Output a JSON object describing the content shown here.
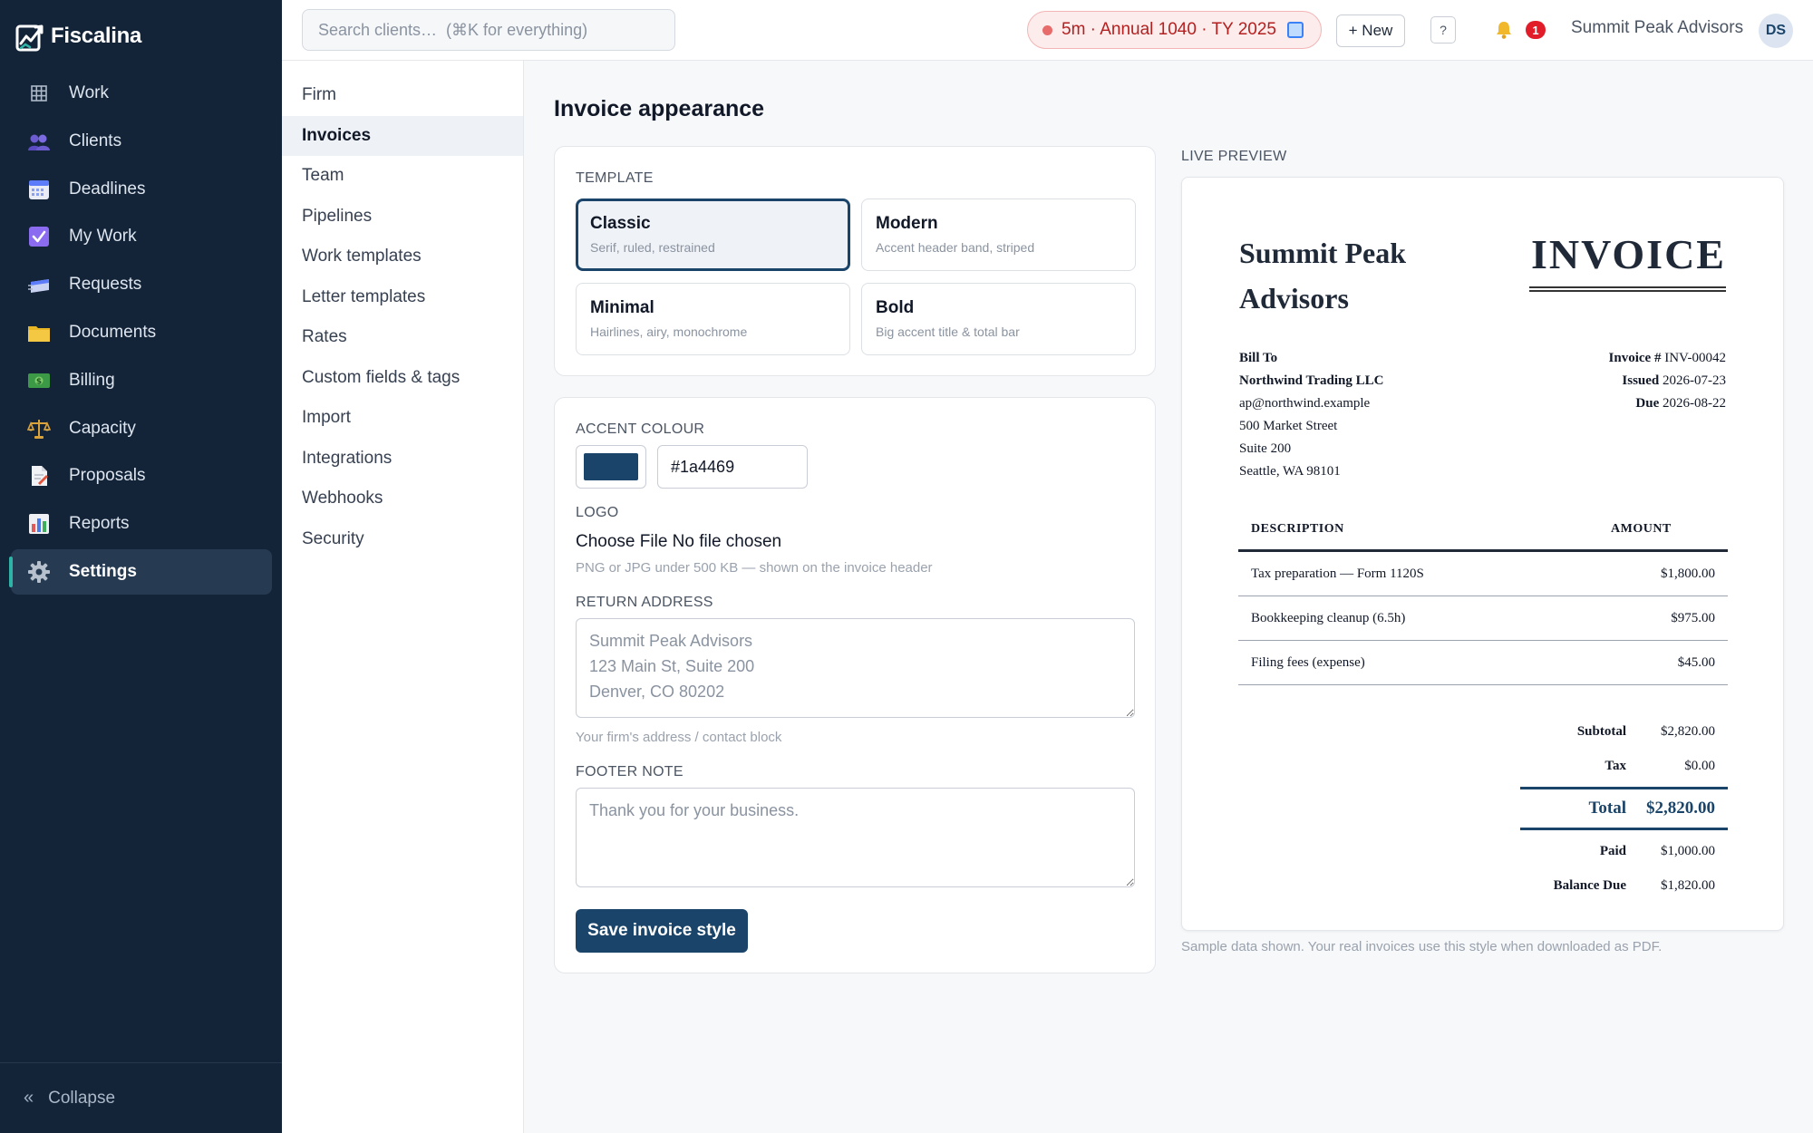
{
  "app": {
    "name": "Fiscalina"
  },
  "sidebar": {
    "items": [
      {
        "label": "Work",
        "icon": "grid-icon"
      },
      {
        "label": "Clients",
        "icon": "people-icon"
      },
      {
        "label": "Deadlines",
        "icon": "calendar-icon"
      },
      {
        "label": "My Work",
        "icon": "checkbox-icon"
      },
      {
        "label": "Requests",
        "icon": "inbox-icon"
      },
      {
        "label": "Documents",
        "icon": "folder-icon"
      },
      {
        "label": "Billing",
        "icon": "cash-icon"
      },
      {
        "label": "Capacity",
        "icon": "scales-icon"
      },
      {
        "label": "Proposals",
        "icon": "proposal-icon"
      },
      {
        "label": "Reports",
        "icon": "bar-chart-icon"
      },
      {
        "label": "Settings",
        "icon": "gear-icon",
        "active": true
      }
    ],
    "collapse_label": "Collapse"
  },
  "topbar": {
    "search_placeholder": "Search clients…  (⌘K for everything)",
    "timer_text": "5m · Annual 1040 · TY 2025",
    "new_label": "+ New",
    "help_label": "?",
    "notification_count": "1",
    "firm_name": "Summit Peak Advisors",
    "avatar_initials": "DS"
  },
  "settings_nav": {
    "items": [
      "Firm",
      "Invoices",
      "Team",
      "Pipelines",
      "Work templates",
      "Letter templates",
      "Rates",
      "Custom fields & tags",
      "Import",
      "Integrations",
      "Webhooks",
      "Security"
    ],
    "active": "Invoices"
  },
  "page": {
    "title": "Invoice appearance",
    "template_label": "TEMPLATE",
    "templates": [
      {
        "name": "Classic",
        "desc": "Serif, ruled, restrained",
        "selected": true
      },
      {
        "name": "Modern",
        "desc": "Accent header band, striped"
      },
      {
        "name": "Minimal",
        "desc": "Hairlines, airy, monochrome"
      },
      {
        "name": "Bold",
        "desc": "Big accent title & total bar"
      }
    ],
    "accent_label": "ACCENT COLOUR",
    "accent_value": "#1a4469",
    "logo_label": "LOGO",
    "logo_button": "Choose File",
    "logo_status": "No file chosen",
    "logo_hint": "PNG or JPG under 500 KB — shown on the invoice header",
    "return_address_label": "RETURN ADDRESS",
    "return_address_placeholder": "Summit Peak Advisors\n123 Main St, Suite 200\nDenver, CO 80202",
    "return_address_hint": "Your firm's address / contact block",
    "footer_label": "FOOTER NOTE",
    "footer_placeholder": "Thank you for your business.",
    "save_label": "Save invoice style"
  },
  "preview": {
    "label": "LIVE PREVIEW",
    "firm_name": "Summit Peak Advisors",
    "title": "INVOICE",
    "bill_to_label": "Bill To",
    "bill_to": {
      "company": "Northwind Trading LLC",
      "email": "ap@northwind.example",
      "street": "500 Market Street",
      "suite": "Suite 200",
      "city": "Seattle, WA 98101"
    },
    "meta": {
      "invoice_label": "Invoice #",
      "invoice_number": "INV-00042",
      "issued_label": "Issued",
      "issued": "2026-07-23",
      "due_label": "Due",
      "due": "2026-08-22"
    },
    "columns": {
      "description": "DESCRIPTION",
      "amount": "AMOUNT"
    },
    "lines": [
      {
        "description": "Tax preparation — Form 1120S",
        "amount": "$1,800.00"
      },
      {
        "description": "Bookkeeping cleanup (6.5h)",
        "amount": "$975.00"
      },
      {
        "description": "Filing fees (expense)",
        "amount": "$45.00"
      }
    ],
    "totals": {
      "subtotal_label": "Subtotal",
      "subtotal": "$2,820.00",
      "tax_label": "Tax",
      "tax": "$0.00",
      "total_label": "Total",
      "total": "$2,820.00",
      "paid_label": "Paid",
      "paid": "$1,000.00",
      "balance_label": "Balance Due",
      "balance": "$1,820.00"
    },
    "note": "Sample data shown. Your real invoices use this style when downloaded as PDF."
  },
  "colors": {
    "accent": "#1a4469",
    "sidebar_bg": "#132338",
    "sidebar_active_bar": "#2fb3a6",
    "timer_red": "#b42020"
  }
}
